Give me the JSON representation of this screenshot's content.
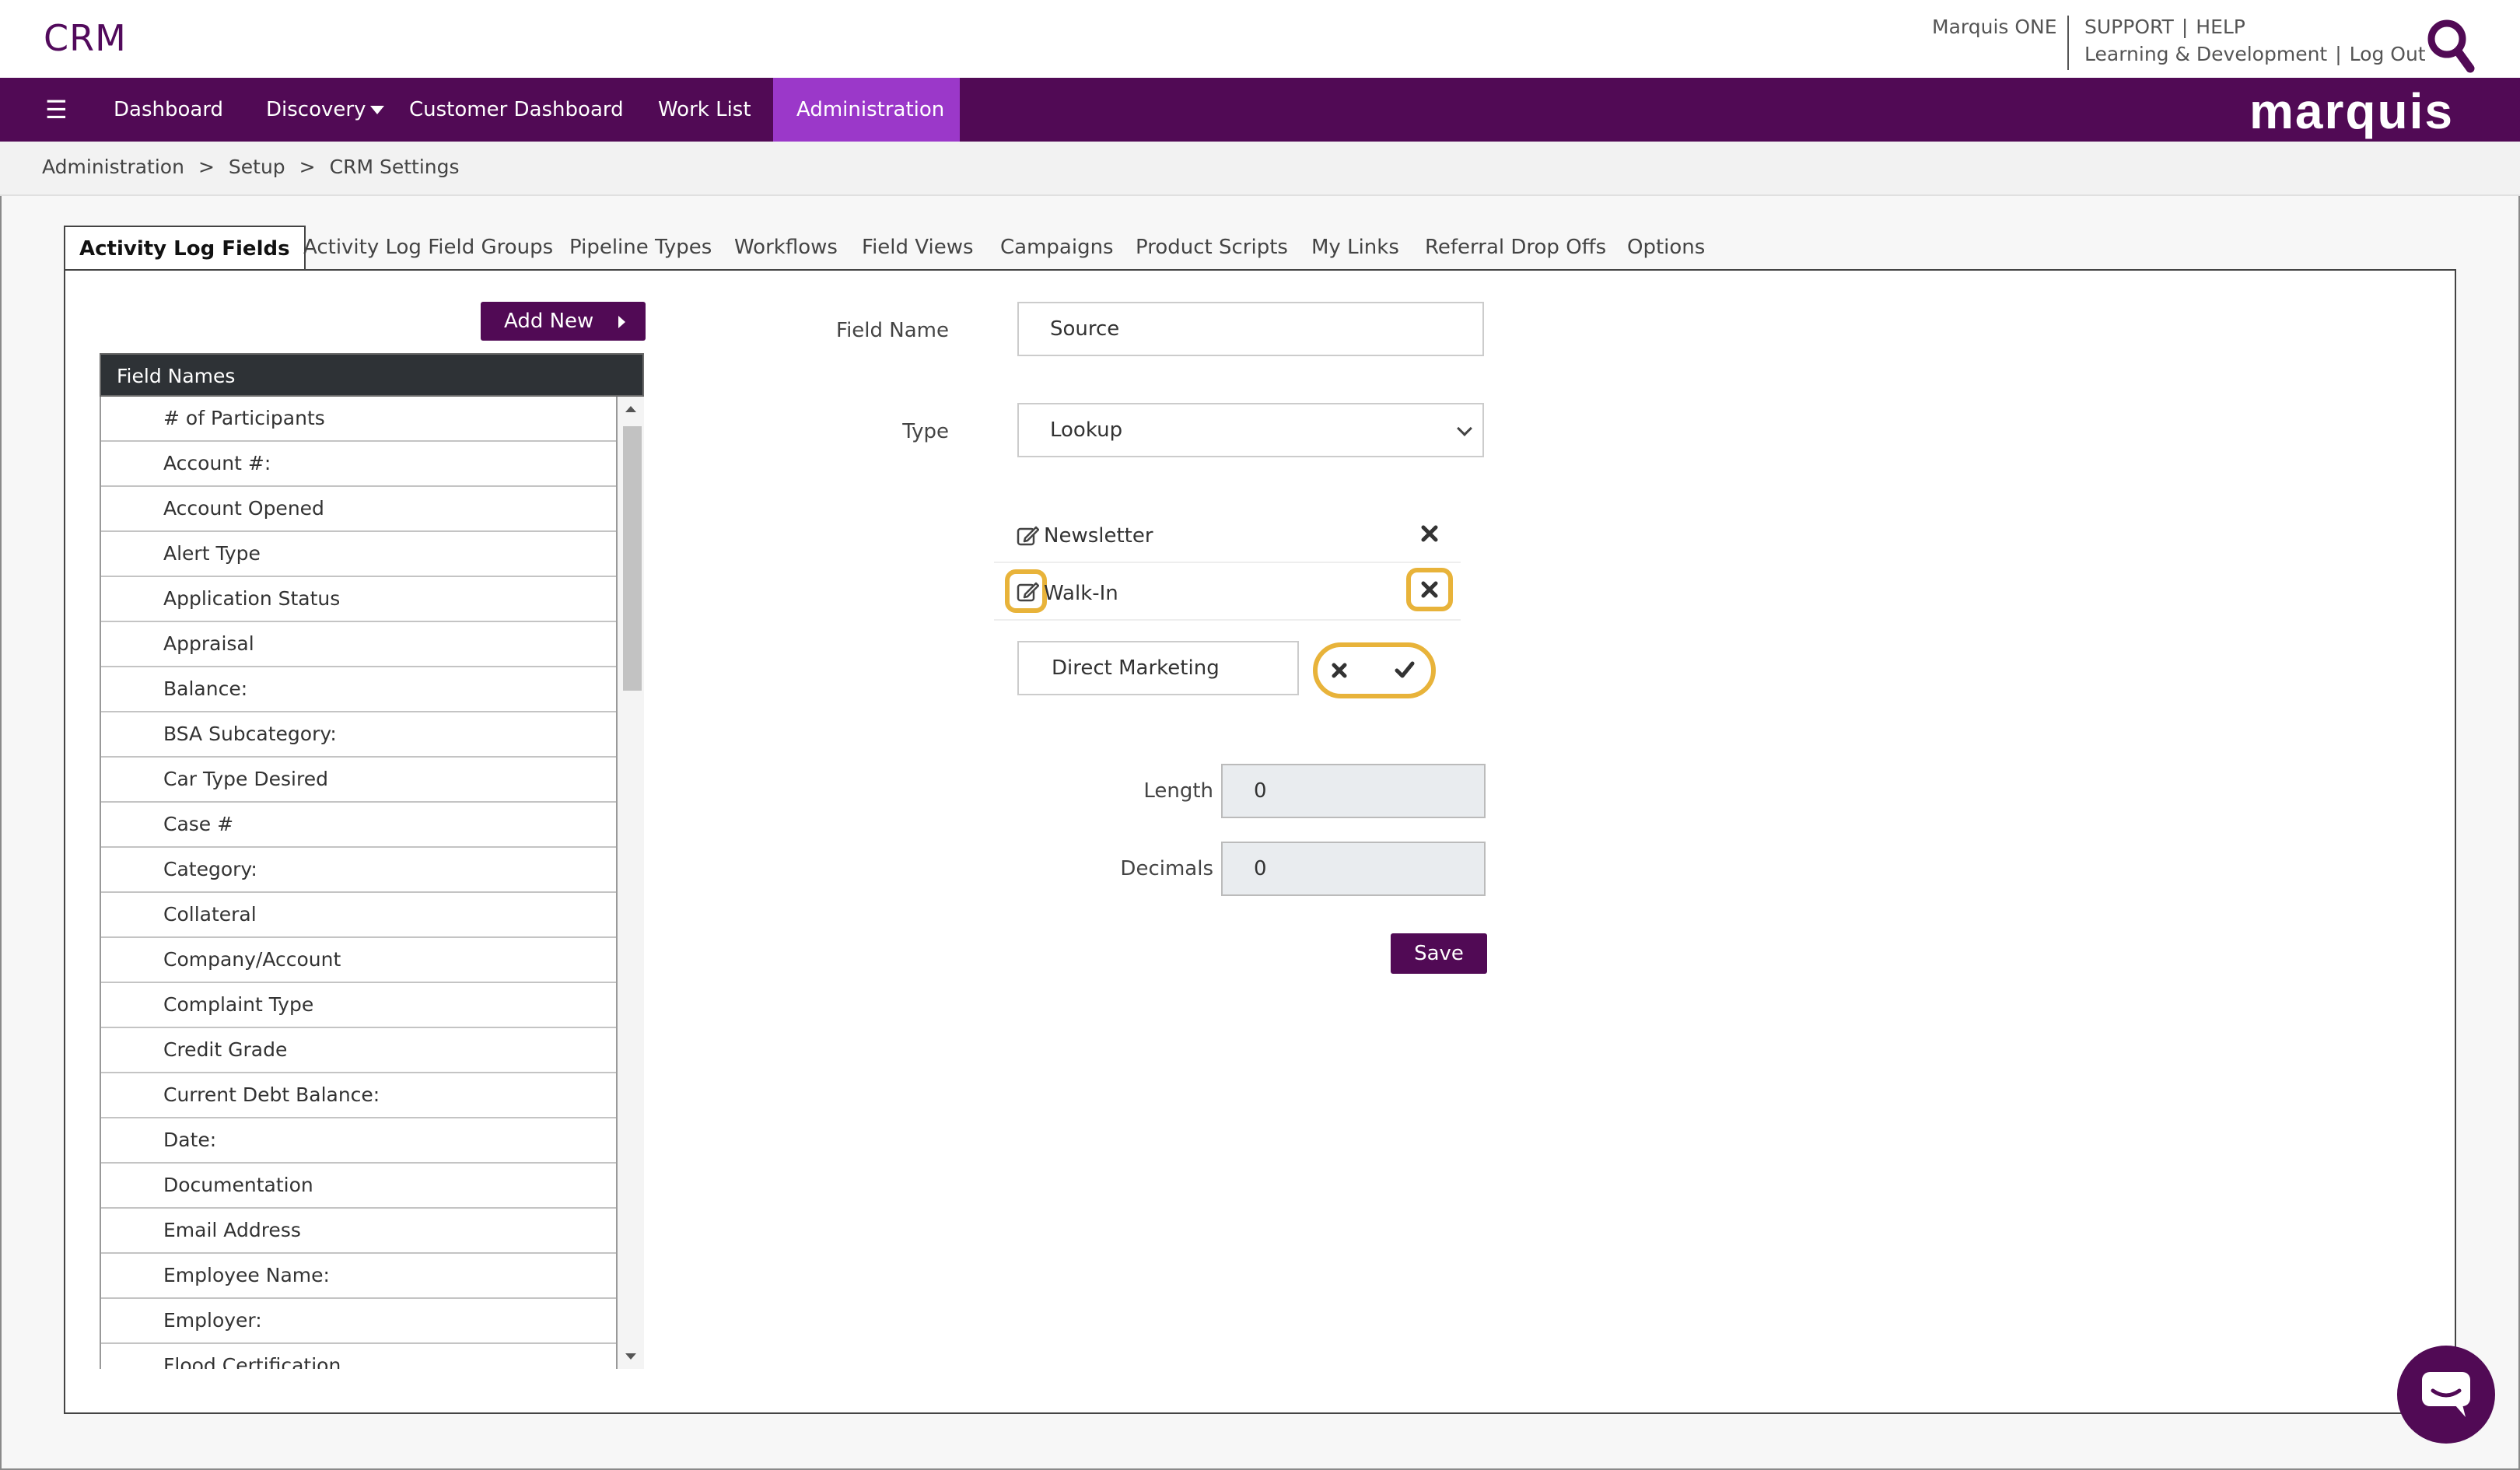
{
  "header": {
    "app_title": "CRM",
    "marquis_one": "Marquis ONE",
    "support": "SUPPORT",
    "help": "HELP",
    "learning": "Learning & Development",
    "logout": "Log Out",
    "pipe": "|"
  },
  "nav": {
    "menu_icon": "hamburger-icon",
    "items": [
      {
        "label": "Dashboard",
        "dropdown": false,
        "active": false
      },
      {
        "label": "Discovery",
        "dropdown": true,
        "active": false
      },
      {
        "label": "Customer Dashboard",
        "dropdown": false,
        "active": false
      },
      {
        "label": "Work List",
        "dropdown": false,
        "active": false
      },
      {
        "label": "Administration",
        "dropdown": true,
        "active": true
      }
    ],
    "brand": "marquis"
  },
  "breadcrumb": {
    "items": [
      "Administration",
      "Setup",
      "CRM Settings"
    ],
    "separator": ">"
  },
  "tabs": [
    "Activity Log Fields",
    "Activity Log Field Groups",
    "Pipeline Types",
    "Workflows",
    "Field Views",
    "Campaigns",
    "Product Scripts",
    "My Links",
    "Referral Drop Offs",
    "Options"
  ],
  "active_tab": "Activity Log Fields",
  "field_list": {
    "add_new_label": "Add New",
    "header": "Field Names",
    "items": [
      "# of Participants",
      "Account #:",
      "Account Opened",
      "Alert Type",
      "Application Status",
      "Appraisal",
      "Balance:",
      "BSA Subcategory:",
      "Car Type Desired",
      "Case #",
      "Category:",
      "Collateral",
      "Company/Account",
      "Complaint Type",
      "Credit Grade",
      "Current Debt Balance:",
      "Date:",
      "Documentation",
      "Email Address",
      "Employee Name:",
      "Employer:",
      "Flood Certification"
    ]
  },
  "form": {
    "field_name_label": "Field Name",
    "field_name_value": "Source",
    "type_label": "Type",
    "type_value": "Lookup",
    "lookup_values": [
      "Newsletter",
      "Walk-In"
    ],
    "new_lookup_value": "Direct Marketing",
    "length_label": "Length",
    "length_value": "0",
    "decimals_label": "Decimals",
    "decimals_value": "0",
    "save_label": "Save"
  },
  "colors": {
    "brand_purple": "#510a55",
    "active_nav": "#9b38c9",
    "highlight": "#e8b33a",
    "list_header": "#2e3236"
  }
}
